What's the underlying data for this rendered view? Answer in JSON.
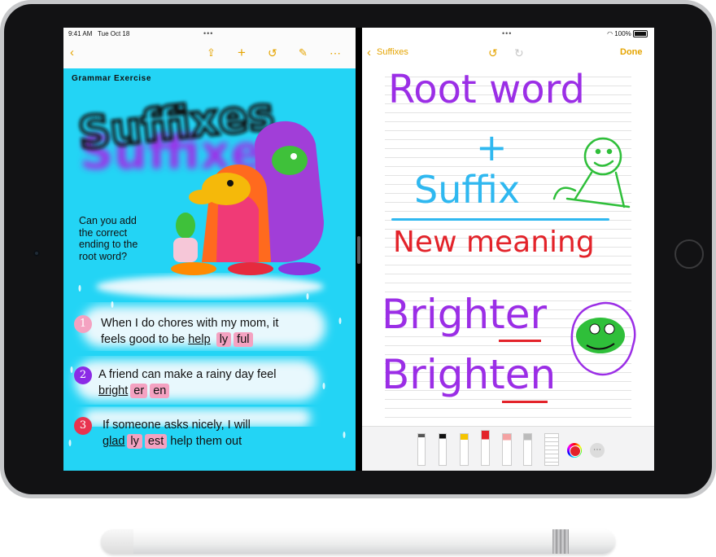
{
  "status": {
    "time": "9:41 AM",
    "date": "Tue Oct 18",
    "battery": "100%"
  },
  "left_pane": {
    "toolbar": {
      "icons": [
        "back-chevron-icon",
        "share-icon",
        "add-icon",
        "undo-icon",
        "markup-pen-icon",
        "more-icon"
      ]
    },
    "heading": "Grammar Exercise",
    "title_art": "Suffixes",
    "question": "Can you add the correct ending to the root word?",
    "exercises": [
      {
        "number": "1",
        "color": "#f4a2c1",
        "line1": "When I do chores with my mom, it",
        "line2_prefix": "feels good to be",
        "root": "help",
        "options": [
          "ly",
          "ful"
        ],
        "line2_suffix": ""
      },
      {
        "number": "2",
        "color": "#8b2be6",
        "line1": "A friend can make a rainy day feel",
        "line2_prefix": "",
        "root": "bright",
        "options": [
          "er",
          "en"
        ],
        "line2_suffix": ""
      },
      {
        "number": "3",
        "color": "#e8344f",
        "line1": "If someone asks nicely, I will",
        "line2_prefix": "",
        "root": "glad",
        "options": [
          "ly",
          "est"
        ],
        "line2_suffix": "help them out"
      }
    ]
  },
  "right_pane": {
    "toolbar": {
      "back_label": "Suffixes",
      "done_label": "Done",
      "icons": [
        "back-chevron-icon",
        "undo-icon",
        "redo-icon"
      ]
    },
    "handwriting": {
      "line1": "Root word",
      "plus": "+",
      "line2": "Suffix",
      "line3": "New meaning",
      "line4": "Brighter",
      "line5": "Brighten"
    },
    "colors": {
      "purple": "#9b2ee6",
      "cyan": "#2fb8f0",
      "red": "#e3232a",
      "green": "#2fbf3a"
    },
    "tools": [
      "pen-tool",
      "marker-tool",
      "highlighter-tool",
      "crayon-tool",
      "eraser-tool",
      "lasso-tool",
      "ruler-tool",
      "color-picker",
      "more-icon"
    ]
  }
}
